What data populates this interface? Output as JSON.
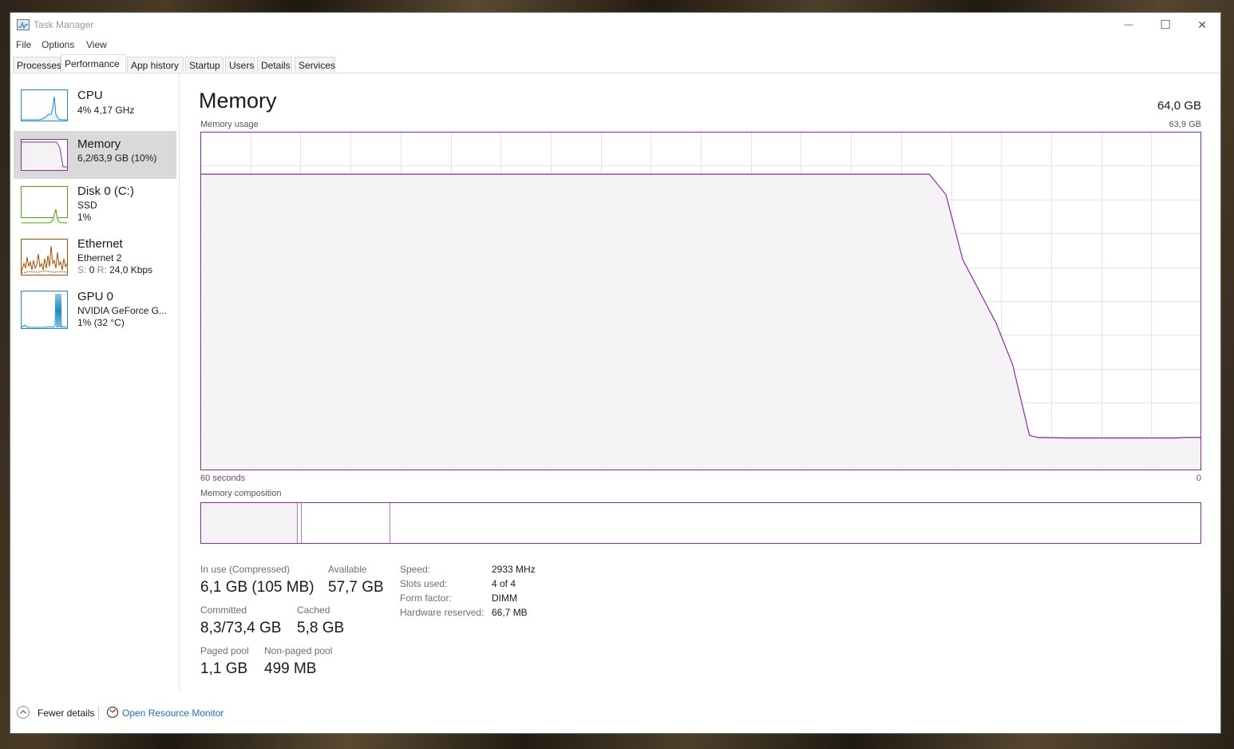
{
  "window": {
    "title": "Task Manager",
    "controls": {
      "minimize": "—",
      "maximize": "☐",
      "close": "✕"
    }
  },
  "menu": [
    "File",
    "Options",
    "View"
  ],
  "tabs": [
    "Processes",
    "Performance",
    "App history",
    "Startup",
    "Users",
    "Details",
    "Services"
  ],
  "active_tab": "Performance",
  "sidebar": {
    "items": [
      {
        "title": "CPU",
        "line1": "4% 4,17 GHz",
        "line2": "",
        "color": "#1c8cc9"
      },
      {
        "title": "Memory",
        "line1": "6,2/63,9 GB (10%)",
        "line2": "",
        "color": "#9028a8"
      },
      {
        "title": "Disk 0 (C:)",
        "line1": "SSD",
        "line2": "1%",
        "color": "#4da60c"
      },
      {
        "title": "Ethernet",
        "line1": "Ethernet 2",
        "send_label": "S:",
        "send_value": "0",
        "recv_label": "R:",
        "recv_value": "24,0 Kbps",
        "color": "#a74f01"
      },
      {
        "title": "GPU 0",
        "line1": "NVIDIA GeForce G...",
        "line2": "1% (32 °C)",
        "color": "#1c8cc9"
      }
    ],
    "selected": "Memory"
  },
  "main": {
    "title": "Memory",
    "total": "64,0 GB",
    "usage_label": "Memory usage",
    "usage_max": "63,9 GB",
    "time_left": "60 seconds",
    "time_right": "0",
    "composition_label": "Memory composition",
    "accent_color": "#9028a8"
  },
  "chart_data": {
    "type": "area",
    "title": "Memory usage",
    "xlabel": "",
    "ylabel": "",
    "x_unit": "seconds ago",
    "xlim": [
      60,
      0
    ],
    "ylim": [
      0,
      63.9
    ],
    "grid": true,
    "series": [
      {
        "x": [
          60,
          16.3,
          15.3,
          14.3,
          12.3,
          11.3,
          10.3,
          9.8,
          8.3,
          1.5,
          1.0,
          0
        ],
        "values": [
          55.9,
          55.9,
          52.0,
          39.8,
          27.8,
          19.9,
          6.6,
          6.2,
          6.1,
          6.1,
          6.2,
          6.2
        ]
      }
    ]
  },
  "composition": {
    "in_use_gb": 6.1,
    "modified_gb": 0.2,
    "standby_gb": 5.6,
    "total_gb": 63.9
  },
  "stats": {
    "in_use_label": "In use (Compressed)",
    "in_use_value": "6,1 GB (105 MB)",
    "available_label": "Available",
    "available_value": "57,7 GB",
    "committed_label": "Committed",
    "committed_value": "8,3/73,4 GB",
    "cached_label": "Cached",
    "cached_value": "5,8 GB",
    "paged_label": "Paged pool",
    "paged_value": "1,1 GB",
    "nonpaged_label": "Non-paged pool",
    "nonpaged_value": "499 MB"
  },
  "specs": [
    {
      "label": "Speed:",
      "value": "2933 MHz"
    },
    {
      "label": "Slots used:",
      "value": "4 of 4"
    },
    {
      "label": "Form factor:",
      "value": "DIMM"
    },
    {
      "label": "Hardware reserved:",
      "value": "66,7 MB"
    }
  ],
  "footer": {
    "fewer_details": "Fewer details",
    "open_monitor": "Open Resource Monitor"
  }
}
